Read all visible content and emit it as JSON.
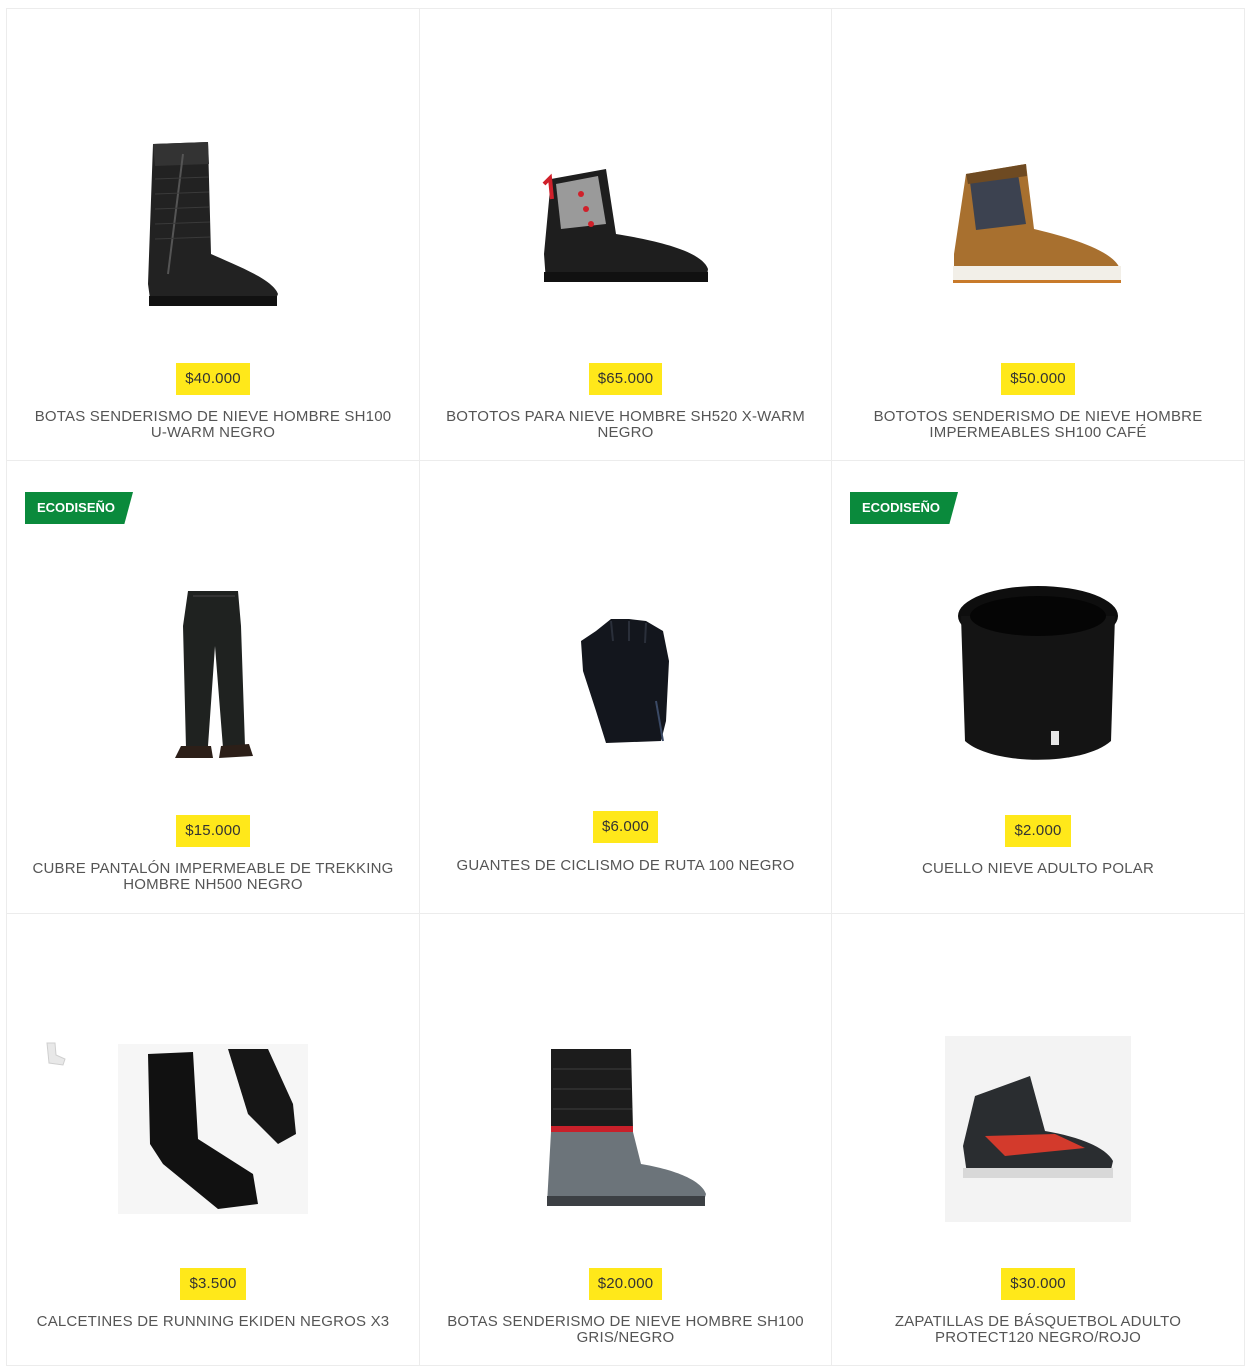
{
  "products": [
    {
      "price": "$40.000",
      "title": "BOTAS SENDERISMO DE NIEVE HOMBRE SH100 U-WARM NEGRO",
      "badge": "",
      "image": "black-winter-boot"
    },
    {
      "price": "$65.000",
      "title": "BOTOTOS PARA NIEVE HOMBRE SH520 X-WARM NEGRO",
      "badge": "",
      "image": "black-red-hiking-boot"
    },
    {
      "price": "$50.000",
      "title": "BOTOTOS SENDERISMO DE NIEVE HOMBRE IMPERMEABLES SH100 CAFÉ",
      "badge": "",
      "image": "brown-hiking-boot"
    },
    {
      "price": "$15.000",
      "title": "CUBRE PANTALÓN IMPERMEABLE DE TREKKING HOMBRE NH500 NEGRO",
      "badge": "ECODISEÑO",
      "image": "black-rain-pants"
    },
    {
      "price": "$6.000",
      "title": "GUANTES DE CICLISMO DE RUTA 100 NEGRO",
      "badge": "",
      "image": "black-cycling-glove"
    },
    {
      "price": "$2.000",
      "title": "CUELLO NIEVE ADULTO POLAR",
      "badge": "ECODISEÑO",
      "image": "black-neck-warmer"
    },
    {
      "price": "$3.500",
      "title": "CALCETINES DE RUNNING EKIDEN NEGROS X3",
      "badge": "",
      "image": "black-running-socks"
    },
    {
      "price": "$20.000",
      "title": "BOTAS SENDERISMO DE NIEVE HOMBRE SH100 GRIS/NEGRO",
      "badge": "",
      "image": "grey-snow-boot"
    },
    {
      "price": "$30.000",
      "title": "ZAPATILLAS DE BÁSQUETBOL ADULTO PROTECT120 NEGRO/ROJO",
      "badge": "",
      "image": "basketball-shoe"
    }
  ],
  "colors": {
    "price_bg": "#ffe81a",
    "badge_bg": "#0a8a3c",
    "text": "#555555"
  }
}
